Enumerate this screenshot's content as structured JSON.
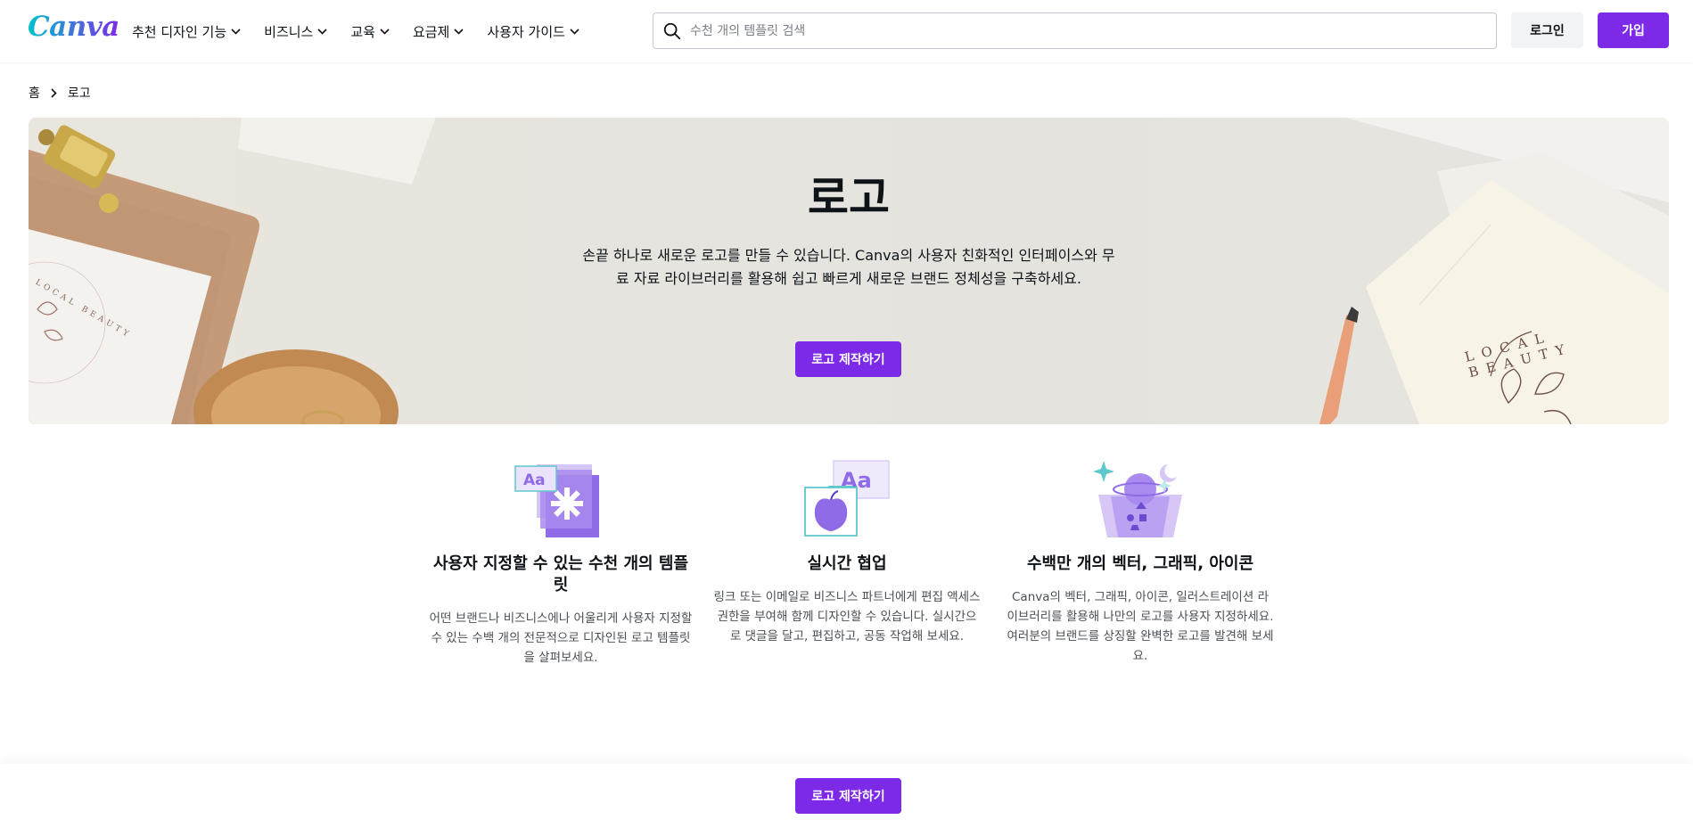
{
  "brand": {
    "logo_text": "Canva",
    "accent": "#7d2ae8",
    "logo_gradient": [
      "#00c4cc",
      "#7d2ae8"
    ]
  },
  "nav": {
    "items": [
      {
        "label": "추천 디자인 기능"
      },
      {
        "label": "비즈니스"
      },
      {
        "label": "교육"
      },
      {
        "label": "요금제"
      },
      {
        "label": "사용자 가이드"
      }
    ]
  },
  "search": {
    "placeholder": "수천 개의 템플릿 검색",
    "value": ""
  },
  "auth": {
    "login_label": "로그인",
    "signup_label": "가입"
  },
  "breadcrumb": {
    "home": "홈",
    "current": "로고"
  },
  "hero": {
    "title": "로고",
    "description": "손끝 하나로 새로운 로고를 만들 수 있습니다. Canva의 사용자 친화적인 인터페이스와 무료 자료 라이브러리를 활용해 쉽고 빠르게 새로운 브랜드 정체성을 구축하세요.",
    "cta_label": "로고 제작하기",
    "decor_left_text": "LOCAL BEAUTY",
    "decor_right_text": "LOCAL BEAUTY"
  },
  "features": [
    {
      "icon": "templates-illustration",
      "title": "사용자 지정할 수 있는 수천 개의 템플릿",
      "description": "어떤 브랜드나 비즈니스에나 어울리게 사용자 지정할 수 있는 수백 개의 전문적으로 디자인된 로고 템플릿을 살펴보세요."
    },
    {
      "icon": "collaboration-illustration",
      "title": "실시간 협업",
      "description": "링크 또는 이메일로 비즈니스 파트너에게 편집 액세스 권한을 부여해 함께 디자인할 수 있습니다. 실시간으로 댓글을 달고, 편집하고, 공동 작업해 보세요."
    },
    {
      "icon": "graphics-illustration",
      "title": "수백만 개의 벡터, 그래픽, 아이콘",
      "description": "Canva의 벡터, 그래픽, 아이콘, 일러스트레이션 라이브러리를 활용해 나만의 로고를 사용자 지정하세요. 여러분의 브랜드를 상징할 완벽한 로고를 발견해 보세요."
    }
  ],
  "illustration_text": {
    "aa": "Aa"
  },
  "sticky_footer": {
    "cta_label": "로고 제작하기"
  }
}
